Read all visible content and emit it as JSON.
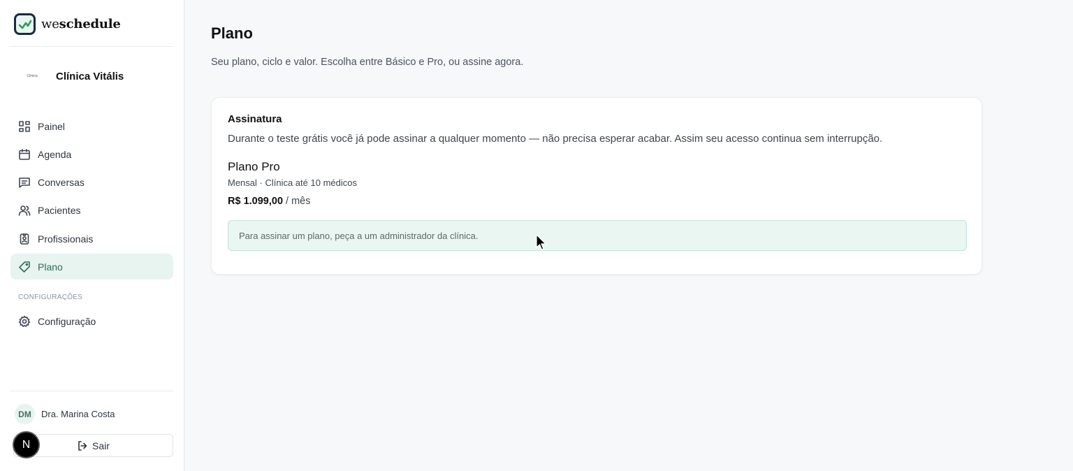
{
  "brand": {
    "prefix": "we",
    "name": "schedule"
  },
  "clinic": {
    "logo_text": "Clínica",
    "name": "Clínica Vitális"
  },
  "sidebar": {
    "items": [
      {
        "label": "Painel",
        "icon": "dashboard-icon"
      },
      {
        "label": "Agenda",
        "icon": "calendar-icon"
      },
      {
        "label": "Conversas",
        "icon": "message-icon"
      },
      {
        "label": "Pacientes",
        "icon": "users-icon"
      },
      {
        "label": "Profissionais",
        "icon": "badge-icon"
      },
      {
        "label": "Plano",
        "icon": "tag-icon",
        "active": true
      }
    ],
    "section_label": "CONFIGURAÇÕES",
    "settings_item": {
      "label": "Configuração",
      "icon": "gear-icon"
    }
  },
  "user": {
    "initials": "DM",
    "name": "Dra. Marina Costa"
  },
  "logout_label": "Sair",
  "n_badge": "N",
  "page": {
    "title": "Plano",
    "subtitle": "Seu plano, ciclo e valor. Escolha entre Básico e Pro, ou assine agora."
  },
  "card": {
    "title": "Assinatura",
    "description": "Durante o teste grátis você já pode assinar a qualquer momento — não precisa esperar acabar. Assim seu acesso continua sem interrupção.",
    "plan_name": "Plano Pro",
    "plan_meta": "Mensal · Clínica até 10 médicos",
    "price": "R$ 1.099,00",
    "price_period": "/ mês",
    "notice": "Para assinar um plano, peça a um administrador da clínica."
  },
  "colors": {
    "accent": "#2f6e58",
    "active_bg": "#e7f4ef",
    "notice_bg": "#eaf6f1"
  }
}
